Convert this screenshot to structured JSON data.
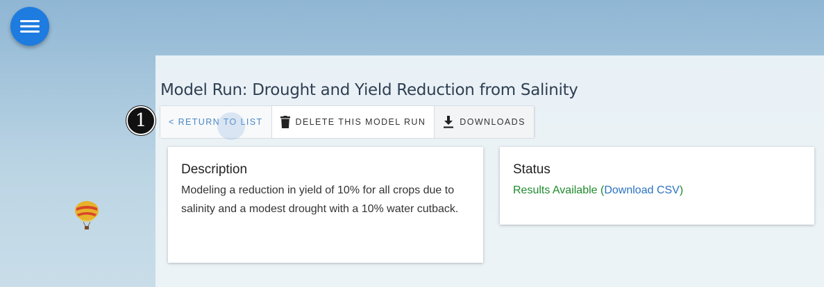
{
  "menu": {
    "icon": "hamburger-menu-icon"
  },
  "page": {
    "title": "Model Run: Drought and Yield Reduction from Salinity"
  },
  "toolbar": {
    "return_label": "< RETURN TO LIST",
    "delete_label": "DELETE THIS MODEL RUN",
    "delete_icon": "trash-icon",
    "downloads_label": "DOWNLOADS",
    "downloads_icon": "download-icon"
  },
  "marker": {
    "label": "1"
  },
  "description": {
    "heading": "Description",
    "text": "Modeling a reduction in yield of 10% for all crops due to salinity and a modest drought with a 10% water cutback."
  },
  "status": {
    "heading": "Status",
    "state": "Results Available",
    "open_paren": "(",
    "link_label": "Download CSV",
    "close_paren": ")"
  },
  "colors": {
    "accent": "#1e7be0",
    "success": "#1f8a2c",
    "link": "#2a72c0"
  }
}
